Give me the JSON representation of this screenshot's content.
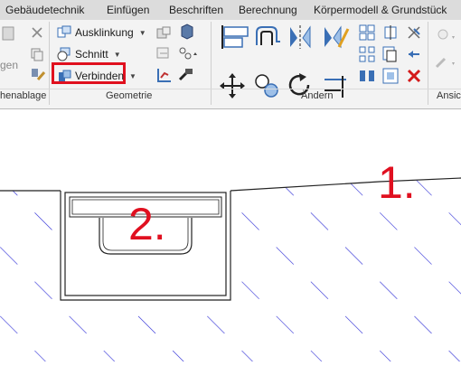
{
  "tabs": [
    {
      "label": "Gebäudetechnik"
    },
    {
      "label": "Einfügen"
    },
    {
      "label": "Beschriften"
    },
    {
      "label": "Berechnung"
    },
    {
      "label": "Körpermodell & Grundstück"
    }
  ],
  "ribbon": {
    "left_partial_label": "gen",
    "panels": {
      "clipboard_partial_title": "henablage",
      "geometry_title": "Geometrie",
      "modify_title": "Ändern",
      "view_partial_title": "Ansic"
    },
    "buttons": {
      "cope": "Ausklinkung",
      "cut": "Schnitt",
      "join": "Verbinden"
    }
  },
  "annotations": {
    "label1": "1.",
    "label2": "2."
  },
  "colors": {
    "highlight": "#e0101e",
    "hatch": "#2b2bd6",
    "annotation": "#e01020"
  }
}
